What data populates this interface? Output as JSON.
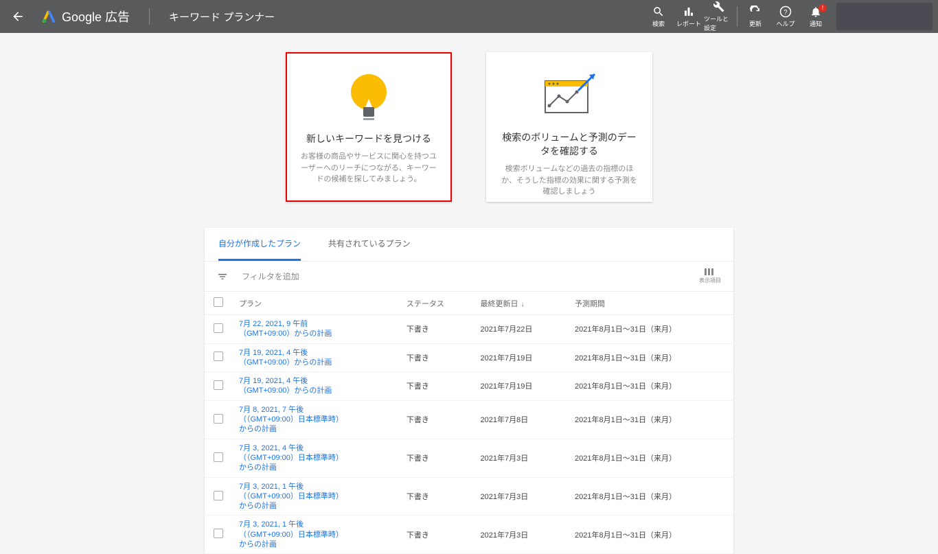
{
  "header": {
    "brand": "Google 広告",
    "page_title": "キーワード プランナー",
    "tools": [
      {
        "name": "search-icon",
        "label": "検索"
      },
      {
        "name": "reports-icon",
        "label": "レポート"
      },
      {
        "name": "tools-icon",
        "label": "ツールと設定"
      }
    ],
    "tools2": [
      {
        "name": "refresh-icon",
        "label": "更新"
      },
      {
        "name": "help-icon",
        "label": "ヘルプ"
      },
      {
        "name": "notifications-icon",
        "label": "通知",
        "badge": "!"
      }
    ]
  },
  "cards": {
    "discover": {
      "title": "新しいキーワードを見つける",
      "desc": "お客様の商品やサービスに関心を持つユーザーへのリーチにつながる、キーワードの候補を探してみましょう。"
    },
    "forecast": {
      "title": "検索のボリュームと予測のデータを確認する",
      "desc": "検索ボリュームなどの過去の指標のほか、そうした指標の効果に関する予測を確認しましょう"
    }
  },
  "tabs": {
    "mine": "自分が作成したプラン",
    "shared": "共有されているプラン"
  },
  "filter": {
    "placeholder": "フィルタを追加",
    "columns_label": "表示項目"
  },
  "columns": {
    "plan": "プラン",
    "status": "ステータス",
    "updated": "最終更新日",
    "period": "予測期間"
  },
  "rows": [
    {
      "plan": "7月 22, 2021, 9 午前（GMT+09:00）からの計画",
      "status": "下書き",
      "updated": "2021年7月22日",
      "period": "2021年8月1日～31日（来月）"
    },
    {
      "plan": "7月 19, 2021, 4 午後（GMT+09:00）からの計画",
      "status": "下書き",
      "updated": "2021年7月19日",
      "period": "2021年8月1日～31日（来月）"
    },
    {
      "plan": "7月 19, 2021, 4 午後（GMT+09:00）からの計画",
      "status": "下書き",
      "updated": "2021年7月19日",
      "period": "2021年8月1日～31日（来月）"
    },
    {
      "plan": "7月 8, 2021, 7 午後（（GMT+09:00）日本標準時）からの計画",
      "status": "下書き",
      "updated": "2021年7月8日",
      "period": "2021年8月1日～31日（来月）"
    },
    {
      "plan": "7月 3, 2021, 4 午後（（GMT+09:00）日本標準時）からの計画",
      "status": "下書き",
      "updated": "2021年7月3日",
      "period": "2021年8月1日～31日（来月）"
    },
    {
      "plan": "7月 3, 2021, 1 午後（（GMT+09:00）日本標準時）からの計画",
      "status": "下書き",
      "updated": "2021年7月3日",
      "period": "2021年8月1日～31日（来月）"
    },
    {
      "plan": "7月 3, 2021, 1 午後（（GMT+09:00）日本標準時）からの計画",
      "status": "下書き",
      "updated": "2021年7月3日",
      "period": "2021年8月1日～31日（来月）"
    }
  ]
}
